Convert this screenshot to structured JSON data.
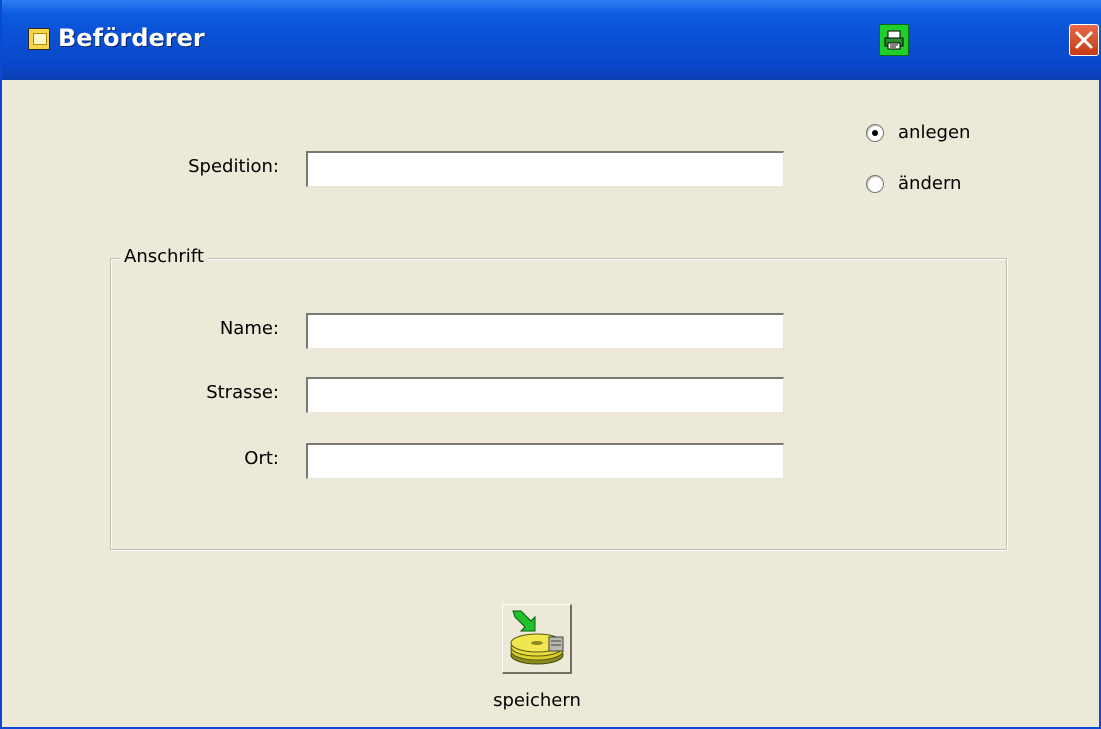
{
  "window": {
    "title": "Beförderer",
    "title_icon": "form-icon",
    "print_icon": "printer-icon",
    "close_icon": "close-icon"
  },
  "form": {
    "spedition_label": "Spedition:",
    "spedition_value": "",
    "mode_options": [
      {
        "label": "anlegen",
        "selected": true
      },
      {
        "label": "ändern",
        "selected": false
      }
    ],
    "address_group_label": "Anschrift",
    "name_label": "Name:",
    "name_value": "",
    "strasse_label": "Strasse:",
    "strasse_value": "",
    "ort_label": "Ort:",
    "ort_value": ""
  },
  "actions": {
    "save_label": "speichern",
    "save_icon": "save-disk-icon"
  },
  "colors": {
    "titlebar": "#0a4fd4",
    "background": "#ece9d8",
    "print_button": "#1fcf2a",
    "close_button": "#d9532b"
  }
}
